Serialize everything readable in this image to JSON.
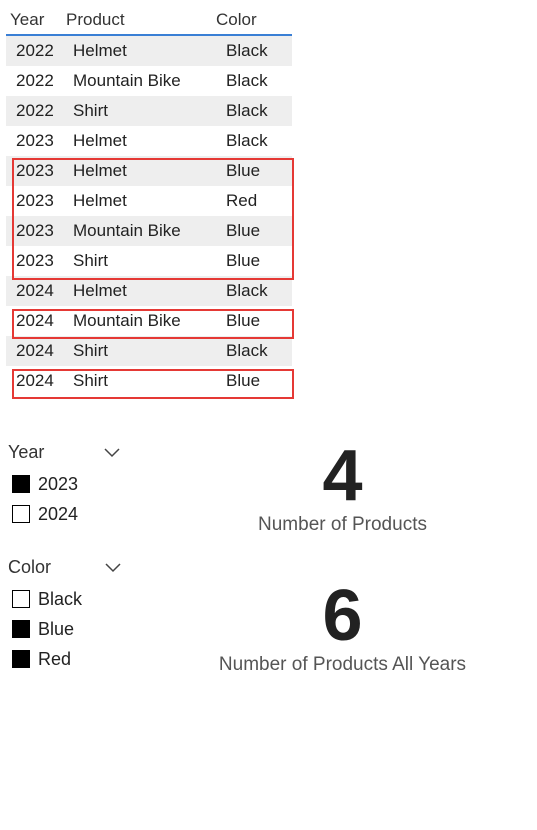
{
  "table": {
    "headers": {
      "year": "Year",
      "product": "Product",
      "color": "Color"
    },
    "rows": [
      {
        "year": "2022",
        "product": "Helmet",
        "color": "Black"
      },
      {
        "year": "2022",
        "product": "Mountain Bike",
        "color": "Black"
      },
      {
        "year": "2022",
        "product": "Shirt",
        "color": "Black"
      },
      {
        "year": "2023",
        "product": "Helmet",
        "color": "Black"
      },
      {
        "year": "2023",
        "product": "Helmet",
        "color": "Blue"
      },
      {
        "year": "2023",
        "product": "Helmet",
        "color": "Red"
      },
      {
        "year": "2023",
        "product": "Mountain Bike",
        "color": "Blue"
      },
      {
        "year": "2023",
        "product": "Shirt",
        "color": "Blue"
      },
      {
        "year": "2024",
        "product": "Helmet",
        "color": "Black"
      },
      {
        "year": "2024",
        "product": "Mountain Bike",
        "color": "Blue"
      },
      {
        "year": "2024",
        "product": "Shirt",
        "color": "Black"
      },
      {
        "year": "2024",
        "product": "Shirt",
        "color": "Blue"
      }
    ]
  },
  "slicers": {
    "year": {
      "title": "Year",
      "items": [
        {
          "label": "2023",
          "selected": true
        },
        {
          "label": "2024",
          "selected": false
        }
      ]
    },
    "color": {
      "title": "Color",
      "items": [
        {
          "label": "Black",
          "selected": false
        },
        {
          "label": "Blue",
          "selected": true
        },
        {
          "label": "Red",
          "selected": true
        }
      ]
    }
  },
  "cards": {
    "products": {
      "value": "4",
      "label": "Number of Products"
    },
    "products_all": {
      "value": "6",
      "label": "Number of Products All Years"
    }
  }
}
